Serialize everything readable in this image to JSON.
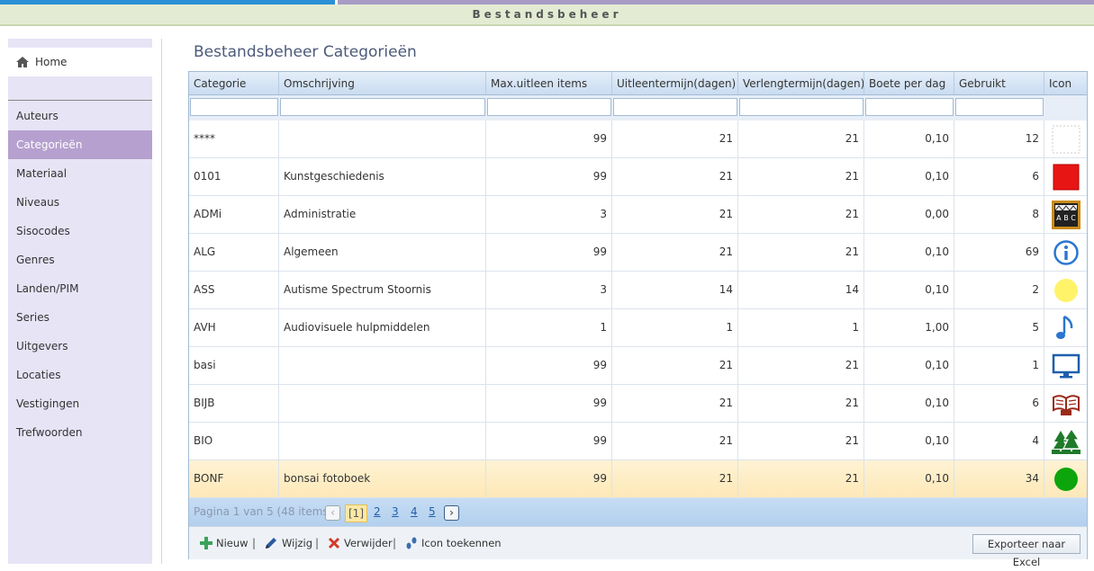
{
  "app": {
    "title": "Bestandsbeheer"
  },
  "sidebar": {
    "home_label": "Home",
    "items": [
      {
        "label": "Auteurs"
      },
      {
        "label": "Categorieën",
        "active": true
      },
      {
        "label": "Materiaal"
      },
      {
        "label": "Niveaus"
      },
      {
        "label": "Sisocodes"
      },
      {
        "label": "Genres"
      },
      {
        "label": "Landen/PIM"
      },
      {
        "label": "Series"
      },
      {
        "label": "Uitgevers"
      },
      {
        "label": "Locaties"
      },
      {
        "label": "Vestigingen"
      },
      {
        "label": "Trefwoorden"
      }
    ]
  },
  "main": {
    "title": "Bestandsbeheer Categorieën"
  },
  "grid": {
    "columns": [
      "Categorie",
      "Omschrijving",
      "Max.uitleen items",
      "Uitleentermijn(dagen)",
      "Verlengtermijn(dagen)",
      "Boete per dag",
      "Gebruikt",
      "Icon"
    ],
    "rows": [
      {
        "cells": [
          "****",
          "",
          "99",
          "21",
          "21",
          "0,10",
          "12"
        ],
        "icon": "blank-icon"
      },
      {
        "cells": [
          "0101",
          "Kunstgeschiedenis",
          "99",
          "21",
          "21",
          "0,10",
          "6"
        ],
        "icon": "red-square-icon"
      },
      {
        "cells": [
          "ADMi",
          "Administratie",
          "3",
          "21",
          "21",
          "0,00",
          "8"
        ],
        "icon": "abc-blocks-icon"
      },
      {
        "cells": [
          "ALG",
          "Algemeen",
          "99",
          "21",
          "21",
          "0,10",
          "69"
        ],
        "icon": "info-icon"
      },
      {
        "cells": [
          "ASS",
          "Autisme Spectrum Stoornis",
          "3",
          "14",
          "14",
          "0,10",
          "2"
        ],
        "icon": "yellow-circle-icon"
      },
      {
        "cells": [
          "AVH",
          "Audiovisuele hulpmiddelen",
          "1",
          "1",
          "1",
          "1,00",
          "5"
        ],
        "icon": "music-note-icon"
      },
      {
        "cells": [
          "basi",
          "",
          "99",
          "21",
          "21",
          "0,10",
          "1"
        ],
        "icon": "monitor-icon"
      },
      {
        "cells": [
          "BIJB",
          "",
          "99",
          "21",
          "21",
          "0,10",
          "6"
        ],
        "icon": "open-book-icon"
      },
      {
        "cells": [
          "BIO",
          "",
          "99",
          "21",
          "21",
          "0,10",
          "4"
        ],
        "icon": "trees-icon"
      },
      {
        "cells": [
          "BONF",
          "bonsai fotoboek",
          "99",
          "21",
          "21",
          "0,10",
          "34"
        ],
        "icon": "green-circle-icon",
        "selected": true
      }
    ]
  },
  "pager": {
    "info": "Pagina 1 van 5 (48 items)",
    "current": "[1]",
    "pages": [
      "2",
      "3",
      "4",
      "5"
    ],
    "prev": "‹",
    "next": "›"
  },
  "toolbar": {
    "new_label": "Nieuw",
    "edit_label": "Wijzig",
    "delete_label": "Verwijder",
    "assign_icon_label": "Icon toekennen",
    "export_label": "Exporteer naar Excel",
    "sep": "|"
  },
  "colors": {
    "accent": "#b6a0cf",
    "selected_row": "#fde8b8",
    "header": "#c9dcf1"
  }
}
